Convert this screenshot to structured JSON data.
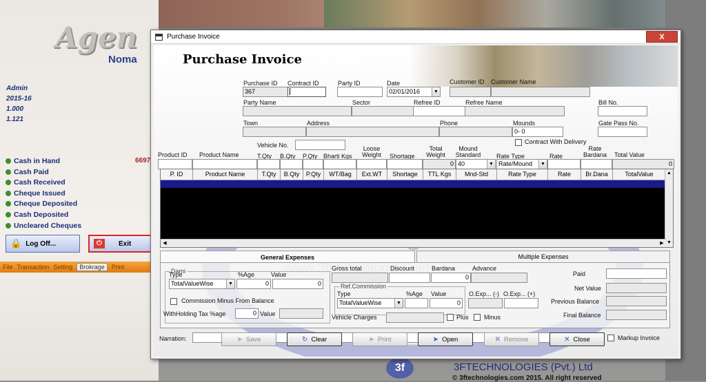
{
  "background": {
    "logo_text": "Agen",
    "logo_sub": "Noma",
    "user": "Admin",
    "year": "2015-16",
    "version1": "1.000",
    "version2": "1.121",
    "menu": [
      "Cash in Hand",
      "Cash Paid",
      "Cash Received",
      "Cheque Issued",
      "Cheque Deposited",
      "Cash Deposited",
      "Uncleared Cheques"
    ],
    "amount": "6697",
    "logoff_label": "Log Off...",
    "exit_label": "Exit",
    "tabbar": [
      "File",
      "Transaction",
      "Setting",
      "Brokrage",
      "Print"
    ],
    "footer_name": "3FTECHNOLOGIES (Pvt.) Ltd",
    "footer_copy": "© 3ftechnologies.com 2015. All right reserved"
  },
  "dialog": {
    "window_title": "Purchase Invoice",
    "close_symbol": "X",
    "form_title": "Purchase Invoice",
    "watermark": "Technologies",
    "watermark_url": "www.3ftechnologies.net",
    "labels": {
      "purchase_id": "Purchase ID",
      "contract_id": "Contract ID",
      "party_id": "Party ID",
      "date": "Date",
      "customer_id": "Customer ID",
      "customer_name": "Customer Name",
      "party_name": "Party Name",
      "sector": "Sector",
      "refree_id": "Refree ID",
      "refree_name": "Refree Name",
      "bill_no": "Bill No.",
      "town": "Town",
      "address": "Address",
      "phone": "Phone",
      "mounds": "Mounds",
      "gate_pass": "Gate Pass No.",
      "contract_delivery": "Contract With Delivery",
      "vehicle_no": "Vehicle No.",
      "product_id": "Product ID",
      "product_name": "Product Name",
      "tqty": "T.Qty",
      "bqty": "B.Qty",
      "pqty": "P.Qty",
      "bharti": "Bharti Kgs",
      "loose_weight": "Loose Weight",
      "shortage": "Shortage",
      "total_weight": "Total Weight",
      "mound_standard": "Mound Standard",
      "rate_type": "Rate Type",
      "rate": "Rate",
      "rate_bardana": "Rate Bardana",
      "total_value": "Total Value"
    },
    "values": {
      "purchase_id": "367",
      "date": "02/01/2016",
      "mounds": "0- 0",
      "total_weight": "0",
      "mound_standard": "40",
      "rate_type": "Rate/Mound",
      "total_value": "0"
    },
    "grid_columns": [
      "P. ID",
      "Product Name",
      "T.Qty",
      "B.Qty",
      "P.Qty",
      "WT/Bag",
      "Ext.WT",
      "Shortage",
      "TTL Kgs",
      "Mnd-Std",
      "Rate Type",
      "Rate",
      "Br.Dana",
      "TotalValue"
    ],
    "tabs": [
      "General Expenses",
      "Multiple Expenses"
    ],
    "general": {
      "dami_group": "Dami",
      "type_label": "Type",
      "age_label": "%Age",
      "value_label": "Value",
      "type_value": "TotalValueWise",
      "age_value": "0",
      "value_value": "0",
      "commission_minus": "Commission Minus From Balance",
      "withholding_label": "WithHolding Tax %age",
      "withholding_value": "0",
      "withholding_value_label": "Value",
      "gross_total": "Gross total",
      "discount": "Discount",
      "bardana": "Bardana",
      "bardana_value": "0",
      "advance": "Advance",
      "ref_commission": "Ref.Commission",
      "ref_type_label": "Type",
      "ref_age_label": "%Age",
      "ref_value_label": "Value",
      "ref_type_value": "TotalValueWise",
      "ref_value_value": "0",
      "oexp_label": "O.Exp... (-)",
      "oexp2_label": "O.Exp... (+)",
      "vehicle_charges": "Vehicle Charges",
      "plus": "Plus",
      "minus": "Minus",
      "paid": "Paid",
      "net_value": "Net Value",
      "previous_balance": "Previous Balance",
      "final_balance": "Final Balance"
    },
    "narration_label": "Narration:",
    "markup_invoice": "Markup Invoice",
    "buttons": {
      "save": "Save",
      "clear": "Clear",
      "print": "Print",
      "open": "Open",
      "remove": "Remove",
      "close": "Close"
    }
  }
}
